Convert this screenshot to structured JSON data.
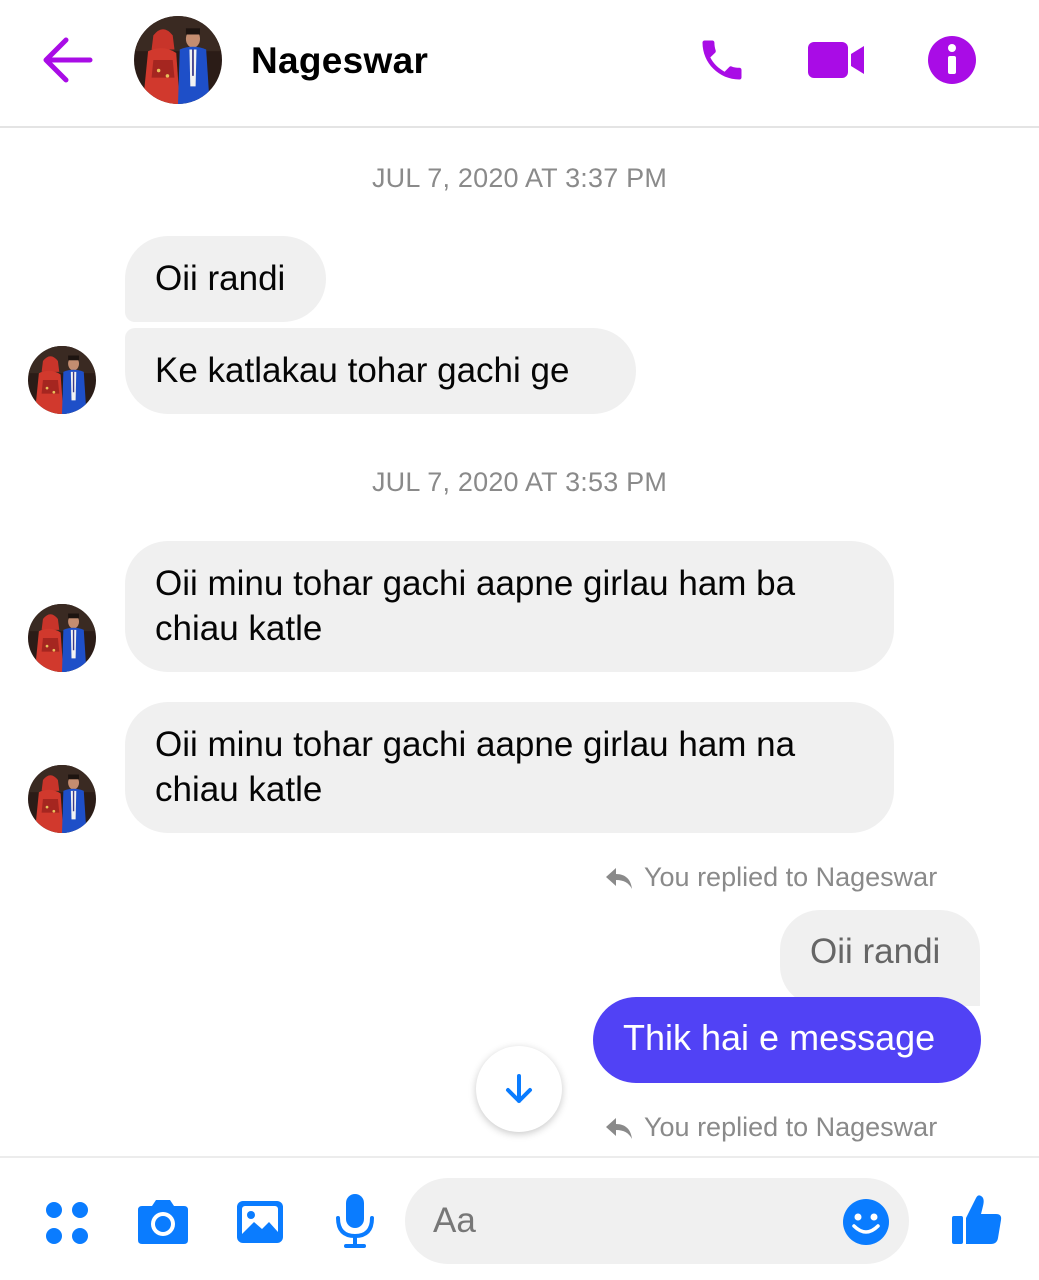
{
  "header": {
    "contact_name": "Nageswar"
  },
  "conversation": {
    "timestamps": [
      "JUL 7, 2020 AT 3:37 PM",
      "JUL 7, 2020 AT 3:53 PM"
    ],
    "received": [
      {
        "line1": "Oii randi"
      },
      {
        "line1": "Ke katlakau tohar gachi ge"
      },
      {
        "line1": "Oii minu tohar gachi aapne girlau ham ba",
        "line2": "chiau katle"
      },
      {
        "line1": "Oii minu tohar gachi aapne girlau ham na",
        "line2": "chiau katle"
      }
    ],
    "reply_notes": [
      "You replied to Nageswar",
      "You replied to Nageswar"
    ],
    "quoted_message": "Oii randi",
    "sent_message": "Thik hai e message"
  },
  "composer": {
    "placeholder": "Aa"
  },
  "colors": {
    "accent_purple": "#a90ce6",
    "messenger_blue": "#0a7cff",
    "sent_bubble": "#5142f5",
    "received_bubble": "#f0f0f0"
  },
  "icons": [
    "back-arrow-icon",
    "phone-icon",
    "video-camera-icon",
    "info-icon",
    "chevron-down-arrow-icon",
    "menu-dots-icon",
    "camera-icon",
    "gallery-icon",
    "microphone-icon",
    "emoji-icon",
    "thumbs-up-icon",
    "reply-arrow-icon"
  ]
}
